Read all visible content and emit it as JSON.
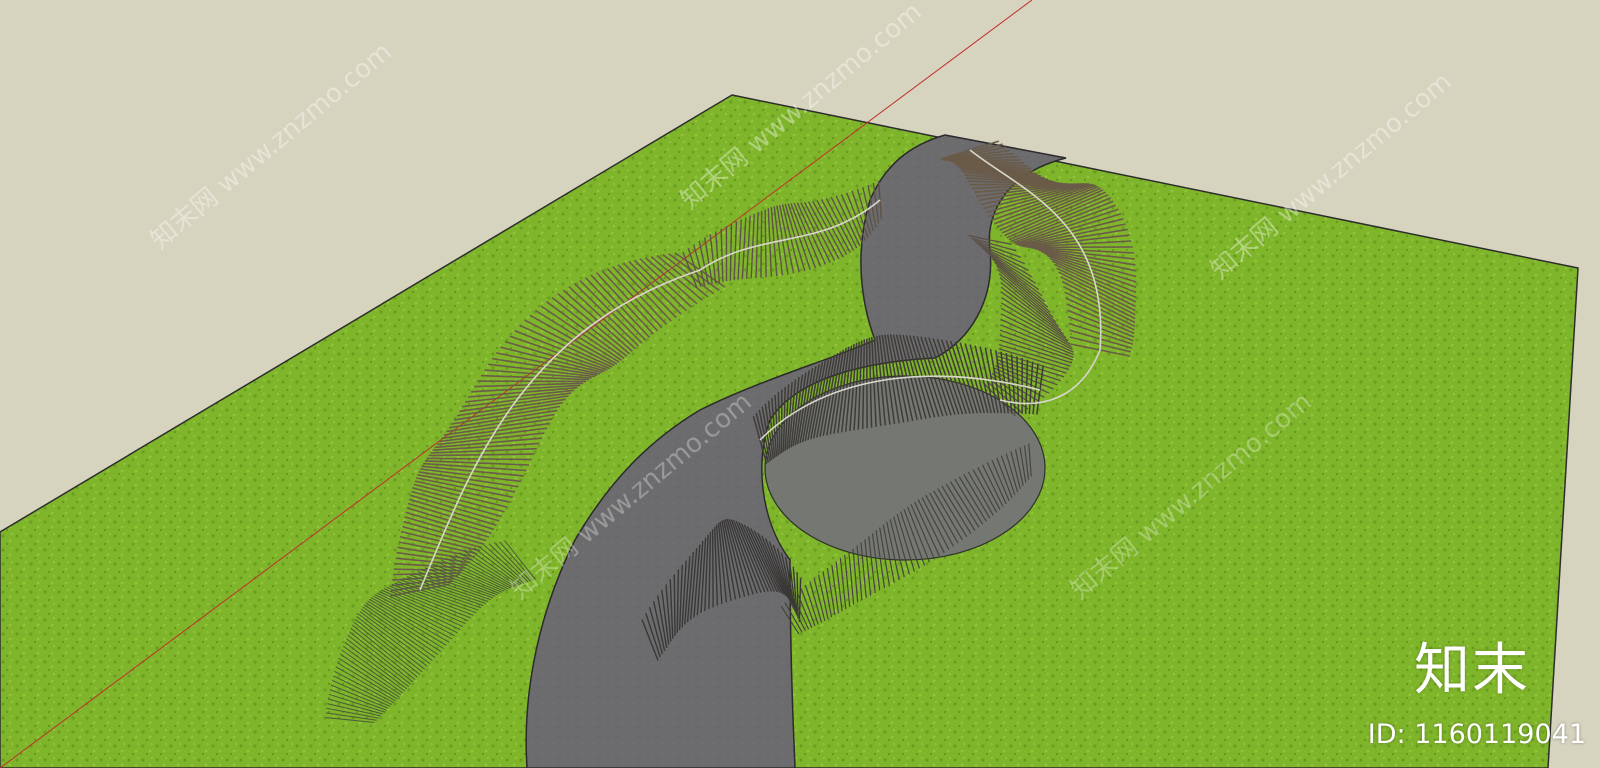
{
  "colors": {
    "sky": "#d6d4be",
    "grass": "#7fb52a",
    "path": "#6e6e70",
    "axis": "#c0302a",
    "structure": "#5a5149"
  },
  "watermark": {
    "text": "知末网 www.znzmo.com",
    "logo": "知末",
    "id": "ID: 1160119041"
  }
}
